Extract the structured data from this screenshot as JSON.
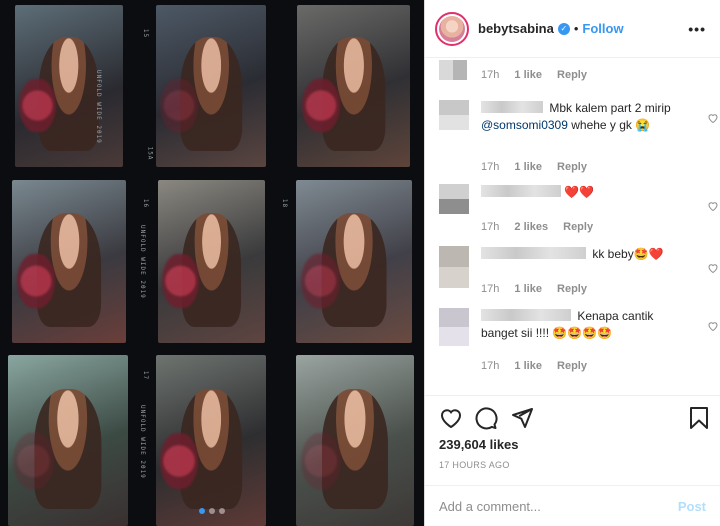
{
  "photo": {
    "film_label_1": "UNFOLD WIDE 2019",
    "film_label_2": "UNFOLD WIDE 2019",
    "film_label_3": "UNFOLD WIDE 2019",
    "frame_numbers": [
      "15",
      "16",
      "17",
      "18"
    ],
    "frame_tag": "15A",
    "carousel_dots": 3,
    "carousel_active": 0
  },
  "header": {
    "username": "bebytsabina",
    "separator": "•",
    "follow_label": "Follow",
    "more_label": "•••",
    "verified_mark": "✓"
  },
  "comments": [
    {
      "text": "",
      "time": "17h",
      "likes": "1 like",
      "reply": "Reply",
      "liked_heart": false
    },
    {
      "text_before": " Mbk kalem part 2 mirip ",
      "mention": "@somsomi0309",
      "text_after": " whehe y gk ",
      "emoji": "😭",
      "time": "17h",
      "likes": "1 like",
      "reply": "Reply"
    },
    {
      "text": "❤️❤️",
      "time": "17h",
      "likes": "2 likes",
      "reply": "Reply"
    },
    {
      "text": " kk beby🤩❤️",
      "time": "17h",
      "likes": "1 like",
      "reply": "Reply"
    },
    {
      "text": " Kenapa cantik banget sii !!!! 🤩🤩🤩🤩",
      "time": "17h",
      "likes": "1 like",
      "reply": "Reply"
    }
  ],
  "actions": {
    "likes_count": "239,604 likes",
    "posted_time": "17 HOURS AGO"
  },
  "add_comment": {
    "placeholder": "Add a comment...",
    "post_label": "Post"
  },
  "colors": {
    "accent": "#3897f0",
    "post_disabled": "#b2dffc",
    "heart_red": "#ed4956",
    "mention": "#00376b"
  }
}
